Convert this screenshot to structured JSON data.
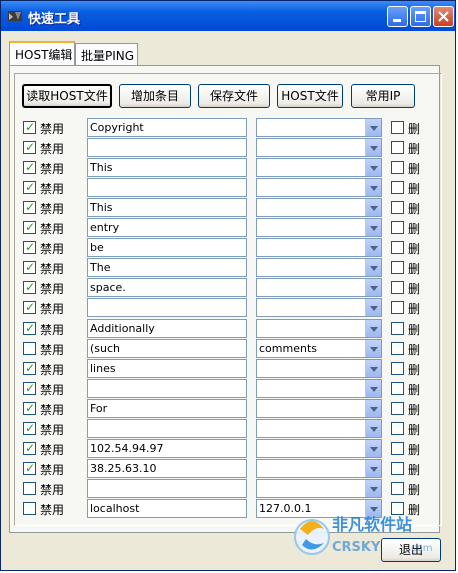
{
  "window": {
    "title": "快速工具"
  },
  "tabs": [
    {
      "label": "HOST编辑",
      "active": true
    },
    {
      "label": "批量PING",
      "active": false
    }
  ],
  "toolbar": {
    "read_host_label": "读取HOST文件",
    "add_entry_label": "增加条目",
    "save_file_label": "保存文件",
    "host_file_label": "HOST文件",
    "common_ip_label": "常用IP"
  },
  "disable_label": "禁用",
  "delete_label": "删",
  "rows": [
    {
      "disabled": true,
      "host": "Copyright",
      "ip": ""
    },
    {
      "disabled": true,
      "host": "",
      "ip": ""
    },
    {
      "disabled": true,
      "host": "This",
      "ip": ""
    },
    {
      "disabled": true,
      "host": "",
      "ip": ""
    },
    {
      "disabled": true,
      "host": "This",
      "ip": ""
    },
    {
      "disabled": true,
      "host": "entry",
      "ip": ""
    },
    {
      "disabled": true,
      "host": "be",
      "ip": ""
    },
    {
      "disabled": true,
      "host": "The",
      "ip": ""
    },
    {
      "disabled": true,
      "host": "space.",
      "ip": ""
    },
    {
      "disabled": true,
      "host": "",
      "ip": ""
    },
    {
      "disabled": true,
      "host": "Additionally",
      "ip": ""
    },
    {
      "disabled": false,
      "host": "(such",
      "ip": "comments"
    },
    {
      "disabled": true,
      "host": "lines",
      "ip": ""
    },
    {
      "disabled": true,
      "host": "",
      "ip": ""
    },
    {
      "disabled": true,
      "host": "For",
      "ip": ""
    },
    {
      "disabled": true,
      "host": "",
      "ip": ""
    },
    {
      "disabled": true,
      "host": "102.54.94.97",
      "ip": ""
    },
    {
      "disabled": true,
      "host": "38.25.63.10",
      "ip": ""
    },
    {
      "disabled": false,
      "host": "",
      "ip": ""
    },
    {
      "disabled": false,
      "host": "localhost",
      "ip": "127.0.0.1"
    }
  ],
  "exit_label": "退出",
  "watermark": {
    "brand_cn": "非凡软件站",
    "brand_en": "CRSKY",
    "domain": ".com"
  }
}
